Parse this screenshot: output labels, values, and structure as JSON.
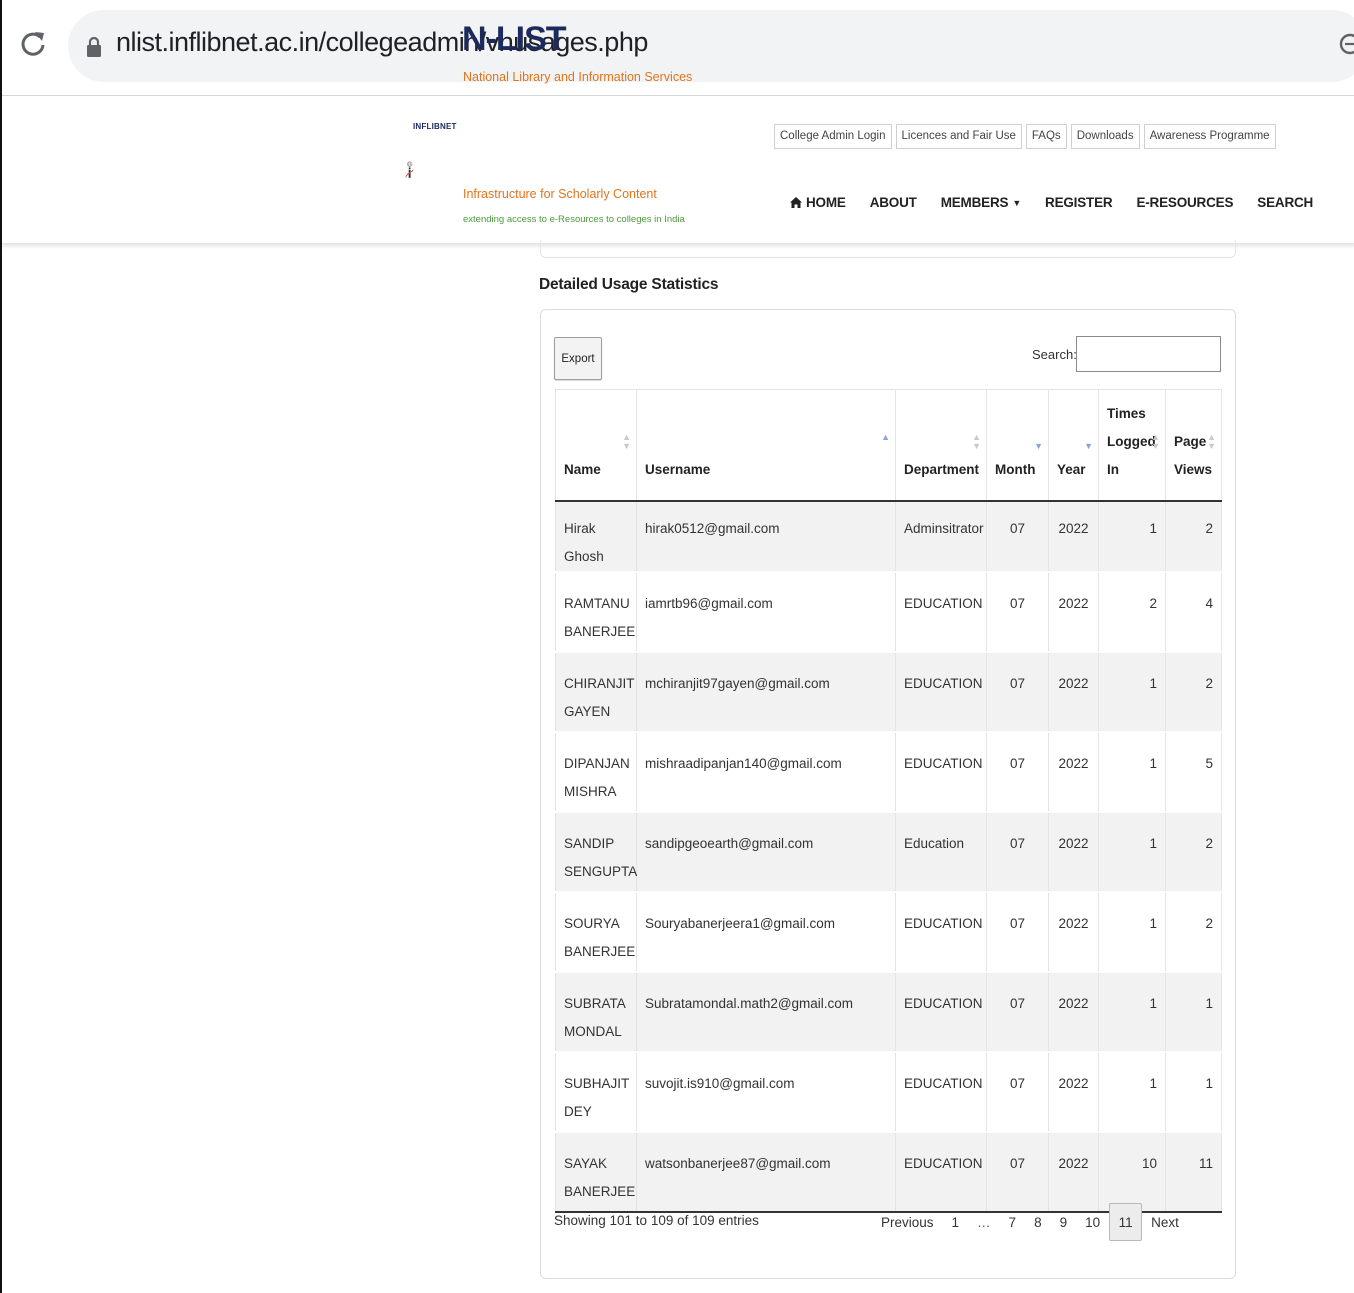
{
  "browser": {
    "url": "nlist.inflibnet.ac.in/collegeadmin/vnusages.php"
  },
  "logo": {
    "title": "N-LIST",
    "line1": "National Library and Information Services",
    "line2": "Infrastructure for Scholarly Content",
    "tagline": "extending access to e-Resources to colleges in India",
    "org": "INFLIBNET"
  },
  "top_links": [
    "College Admin Login",
    "Licences and Fair Use",
    "FAQs",
    "Downloads",
    "Awareness Programme"
  ],
  "nav": {
    "home": "HOME",
    "about": "ABOUT",
    "members": "MEMBERS",
    "register": "REGISTER",
    "eresources": "E-RESOURCES",
    "search": "SEARCH"
  },
  "section_title": "Detailed Usage Statistics",
  "toolbar": {
    "export_label": "Export",
    "search_label": "Search:",
    "search_value": ""
  },
  "table": {
    "headers": {
      "name": "Name",
      "username": "Username",
      "department": "Department",
      "month": "Month",
      "year": "Year",
      "times_l1": "Times",
      "times_l2": "Logged",
      "times_l3": "In",
      "views_l1": "Page",
      "views_l2": "Views"
    },
    "rows": [
      {
        "name": "Hirak Ghosh",
        "username": "hirak0512@gmail.com",
        "department": "Adminsitrator",
        "month": "07",
        "year": "2022",
        "times": "1",
        "views": "2"
      },
      {
        "name": "RAMTANU BANERJEE",
        "username": "iamrtb96@gmail.com",
        "department": "EDUCATION",
        "month": "07",
        "year": "2022",
        "times": "2",
        "views": "4"
      },
      {
        "name": "CHIRANJIT GAYEN",
        "username": "mchiranjit97gayen@gmail.com",
        "department": "EDUCATION",
        "month": "07",
        "year": "2022",
        "times": "1",
        "views": "2"
      },
      {
        "name": "DIPANJAN MISHRA",
        "username": "mishraadipanjan140@gmail.com",
        "department": "EDUCATION",
        "month": "07",
        "year": "2022",
        "times": "1",
        "views": "5"
      },
      {
        "name": "SANDIP SENGUPTA",
        "username": "sandipgeoearth@gmail.com",
        "department": "Education",
        "month": "07",
        "year": "2022",
        "times": "1",
        "views": "2"
      },
      {
        "name": "SOURYA BANERJEE",
        "username": "Souryabanerjeera1@gmail.com",
        "department": "EDUCATION",
        "month": "07",
        "year": "2022",
        "times": "1",
        "views": "2"
      },
      {
        "name": "SUBRATA MONDAL",
        "username": "Subratamondal.math2@gmail.com",
        "department": "EDUCATION",
        "month": "07",
        "year": "2022",
        "times": "1",
        "views": "1"
      },
      {
        "name": "SUBHAJIT DEY",
        "username": "suvojit.is910@gmail.com",
        "department": "EDUCATION",
        "month": "07",
        "year": "2022",
        "times": "1",
        "views": "1"
      },
      {
        "name": "SAYAK BANERJEE",
        "username": "watsonbanerjee87@gmail.com",
        "department": "EDUCATION",
        "month": "07",
        "year": "2022",
        "times": "10",
        "views": "11"
      }
    ]
  },
  "footer": {
    "info": "Showing 101 to 109 of 109 entries",
    "pager": {
      "previous": "Previous",
      "p1": "1",
      "ellipsis": "…",
      "p7": "7",
      "p8": "8",
      "p9": "9",
      "p10": "10",
      "p11": "11",
      "next": "Next"
    }
  },
  "colors": {
    "brand_navy": "#1d2a5c",
    "brand_orange": "#e0741d",
    "brand_green": "#4b9a3a",
    "sort_active": "#8ea1dd"
  }
}
